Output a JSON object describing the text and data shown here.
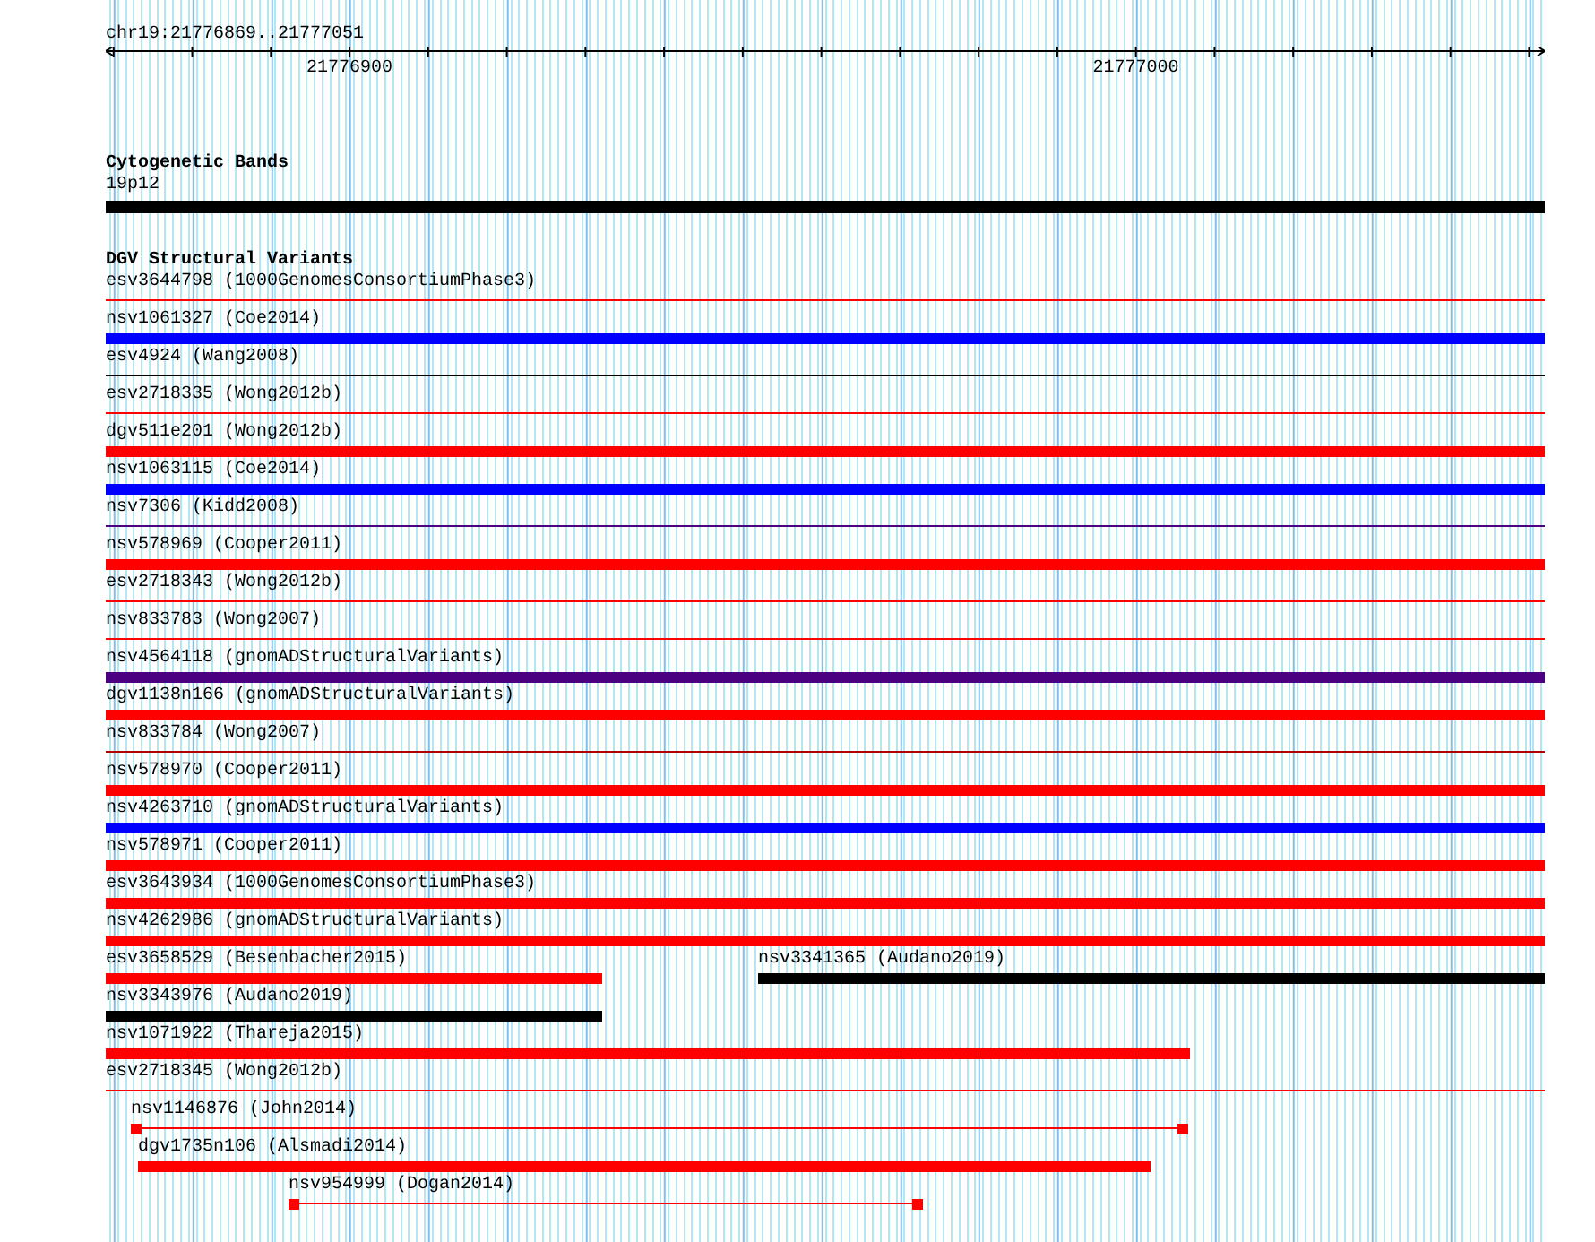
{
  "location": "chr19:21776869..21777051",
  "ruler": {
    "labels": [
      "21776900",
      "21777000"
    ]
  },
  "tracks": [
    {
      "title": "Cytogenetic Bands",
      "kind": "bands",
      "features": [
        {
          "label": "19p12",
          "color": "#000000"
        }
      ]
    },
    {
      "title": "DGV Structural Variants",
      "kind": "variants",
      "rows": [
        {
          "features": [
            {
              "label": "esv3644798 (1000GenomesConsortiumPhase3)",
              "kind": "line",
              "color": "#ff0000"
            }
          ]
        },
        {
          "features": [
            {
              "label": "nsv1061327 (Coe2014)",
              "kind": "bar",
              "color": "#0000ff"
            }
          ]
        },
        {
          "features": [
            {
              "label": "esv4924 (Wang2008)",
              "kind": "line",
              "color": "#000000"
            }
          ]
        },
        {
          "features": [
            {
              "label": "esv2718335 (Wong2012b)",
              "kind": "line",
              "color": "#ff0000"
            }
          ]
        },
        {
          "features": [
            {
              "label": "dgv511e201 (Wong2012b)",
              "kind": "bar",
              "color": "#ff0000"
            }
          ]
        },
        {
          "features": [
            {
              "label": "nsv1063115 (Coe2014)",
              "kind": "bar",
              "color": "#0000ff"
            }
          ]
        },
        {
          "features": [
            {
              "label": "nsv7306 (Kidd2008)",
              "kind": "line",
              "color": "#4b0082"
            }
          ]
        },
        {
          "features": [
            {
              "label": "nsv578969 (Cooper2011)",
              "kind": "bar",
              "color": "#ff0000"
            }
          ]
        },
        {
          "features": [
            {
              "label": "esv2718343 (Wong2012b)",
              "kind": "line",
              "color": "#ff0000"
            }
          ]
        },
        {
          "features": [
            {
              "label": "nsv833783 (Wong2007)",
              "kind": "line",
              "color": "#ff0000"
            }
          ]
        },
        {
          "features": [
            {
              "label": "nsv4564118 (gnomADStructuralVariants)",
              "kind": "bar",
              "color": "#4b0082"
            }
          ]
        },
        {
          "features": [
            {
              "label": "dgv1138n166 (gnomADStructuralVariants)",
              "kind": "bar",
              "color": "#ff0000"
            }
          ]
        },
        {
          "features": [
            {
              "label": "nsv833784 (Wong2007)",
              "kind": "line",
              "color": "#b00000"
            }
          ]
        },
        {
          "features": [
            {
              "label": "nsv578970 (Cooper2011)",
              "kind": "bar",
              "color": "#ff0000"
            }
          ]
        },
        {
          "features": [
            {
              "label": "nsv4263710 (gnomADStructuralVariants)",
              "kind": "bar",
              "color": "#0000ff"
            }
          ]
        },
        {
          "features": [
            {
              "label": "nsv578971 (Cooper2011)",
              "kind": "bar",
              "color": "#ff0000"
            }
          ]
        },
        {
          "features": [
            {
              "label": "esv3643934 (1000GenomesConsortiumPhase3)",
              "kind": "bar",
              "color": "#ff0000"
            }
          ]
        },
        {
          "features": [
            {
              "label": "nsv4262986 (gnomADStructuralVariants)",
              "kind": "bar",
              "color": "#ff0000"
            }
          ]
        },
        {
          "features": [
            {
              "label": "esv3658529 (Besenbacher2015)",
              "kind": "bar",
              "color": "#ff0000"
            },
            {
              "label": "nsv3341365 (Audano2019)",
              "kind": "bar",
              "color": "#000000"
            }
          ]
        },
        {
          "features": [
            {
              "label": "nsv3343976 (Audano2019)",
              "kind": "bar",
              "color": "#000000"
            }
          ]
        },
        {
          "features": [
            {
              "label": "nsv1071922 (Thareja2015)",
              "kind": "bar",
              "color": "#ff0000"
            }
          ]
        },
        {
          "features": [
            {
              "label": "esv2718345 (Wong2012b)",
              "kind": "line",
              "color": "#ff0000"
            }
          ]
        },
        {
          "features": [
            {
              "label": "nsv1146876 (John2014)",
              "kind": "linked",
              "color": "#ff0000"
            }
          ]
        },
        {
          "features": [
            {
              "label": "dgv1735n106 (Alsmadi2014)",
              "kind": "bar",
              "color": "#ff0000"
            }
          ]
        },
        {
          "features": [
            {
              "label": "nsv954999 (Dogan2014)",
              "kind": "linked",
              "color": "#ff0000"
            }
          ]
        }
      ]
    }
  ]
}
